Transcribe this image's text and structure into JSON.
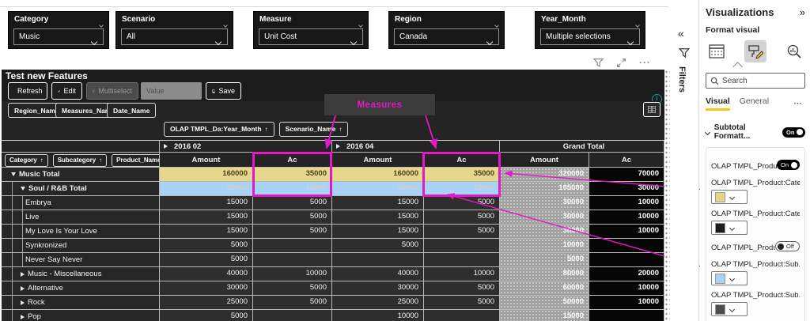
{
  "slicers": [
    {
      "label": "Category",
      "value": "Music"
    },
    {
      "label": "Scenario",
      "value": "All"
    },
    {
      "label": "Measure",
      "value": "Unit Cost"
    },
    {
      "label": "Region",
      "value": "Canada"
    },
    {
      "label": "Year_Month",
      "value": "Multiple selections"
    }
  ],
  "visual": {
    "title": "Test new Features",
    "toolbar": {
      "refresh": "Refresh",
      "edit": "Edit",
      "multiselect": "Multiselect",
      "value_placeholder": "Value",
      "save": "Save"
    },
    "field_chips": [
      "Region_Name",
      "Measures_Name",
      "Date_Name"
    ],
    "column_field_chips": [
      "OLAP TMPL_Da:Year_Month",
      "Scenario_Name"
    ],
    "row_field_chips": [
      "Category",
      "Subcategory",
      "Product_Name"
    ],
    "annotation_label": "Measures",
    "matrix": {
      "column_groups": [
        {
          "label": "2016 02",
          "collapsed": true
        },
        {
          "label": "2016 04",
          "collapsed": true
        },
        {
          "label": "Grand Total",
          "collapsed": false
        }
      ],
      "measure_headers": [
        "Amount",
        "Ac",
        "Amount",
        "Ac",
        "Amount",
        "Ac"
      ],
      "rows": [
        {
          "label": "Music Total",
          "level": 0,
          "icon": "expanded",
          "bold": true,
          "style": "yellow",
          "values": [
            "160000",
            "35000",
            "160000",
            "35000",
            "320000",
            "70000"
          ]
        },
        {
          "label": "Soul / R&B Total",
          "level": 1,
          "icon": "expanded",
          "bold": true,
          "style": "blue",
          "values": [
            "55000",
            "15000",
            "50000",
            "15000",
            "105000",
            "30000"
          ]
        },
        {
          "label": "Embrya",
          "level": 2,
          "icon": "none",
          "bold": false,
          "style": "",
          "values": [
            "15000",
            "5000",
            "15000",
            "5000",
            "30000",
            "10000"
          ]
        },
        {
          "label": "Live",
          "level": 2,
          "icon": "none",
          "bold": false,
          "style": "",
          "values": [
            "15000",
            "5000",
            "15000",
            "5000",
            "30000",
            "10000"
          ]
        },
        {
          "label": "My Love Is Your Love",
          "level": 2,
          "icon": "none",
          "bold": false,
          "style": "",
          "values": [
            "15000",
            "5000",
            "15000",
            "5000",
            "30000",
            "10000"
          ]
        },
        {
          "label": "Synkronized",
          "level": 2,
          "icon": "none",
          "bold": false,
          "style": "",
          "values": [
            "5000",
            "",
            "5000",
            "",
            "10000",
            ""
          ]
        },
        {
          "label": "Never Say Never",
          "level": 2,
          "icon": "none",
          "bold": false,
          "style": "",
          "values": [
            "5000",
            "",
            "",
            "",
            "5000",
            ""
          ]
        },
        {
          "label": "Music - Miscellaneous",
          "level": 1,
          "icon": "collapsed",
          "bold": false,
          "style": "",
          "values": [
            "40000",
            "10000",
            "40000",
            "10000",
            "80000",
            "20000"
          ]
        },
        {
          "label": "Alternative",
          "level": 1,
          "icon": "collapsed",
          "bold": false,
          "style": "",
          "values": [
            "30000",
            "5000",
            "30000",
            "5000",
            "60000",
            "10000"
          ]
        },
        {
          "label": "Rock",
          "level": 1,
          "icon": "collapsed",
          "bold": false,
          "style": "",
          "values": [
            "25000",
            "5000",
            "25000",
            "5000",
            "50000",
            "10000"
          ]
        },
        {
          "label": "Pop",
          "level": 1,
          "icon": "collapsed",
          "bold": false,
          "style": "",
          "values": [
            "5000",
            "",
            "10000",
            "",
            "15000",
            ""
          ]
        }
      ]
    }
  },
  "filters_pane": {
    "label": "Filters"
  },
  "viz_pane": {
    "title": "Visualizations",
    "subtitle": "Format visual",
    "search_placeholder": "Search",
    "tabs": [
      {
        "label": "Visual",
        "active": true
      },
      {
        "label": "General",
        "active": false
      }
    ],
    "section": {
      "label": "Subtotal Formatt...",
      "toggle": "On"
    },
    "card_items": [
      {
        "type": "toggle",
        "label": "OLAP TMPL_Produ...",
        "state": "On"
      },
      {
        "type": "swatch",
        "label": "OLAP TMPL_Product:Cate...",
        "color": "#e6d486"
      },
      {
        "type": "swatch",
        "label": "OLAP TMPL_Product:Cate...",
        "color": "#1c1c1c"
      },
      {
        "type": "toggle",
        "label": "OLAP TMPL_Produ...",
        "state": "Off"
      },
      {
        "type": "swatch",
        "label": "OLAP TMPL_Product:Sub...",
        "color": "#a9d2f7"
      },
      {
        "type": "swatch",
        "label": "OLAP TMPL_Product:Sub...",
        "color": "#4d4d4d"
      }
    ]
  },
  "glyphs": {
    "collapse_left": "«",
    "expand_right": "»",
    "more": "···",
    "sort_asc": "↑"
  },
  "colors": {
    "annotation_magenta": "#e318c8",
    "subtotal_yellow": "#e7d78b",
    "subtotal_blue": "#a9d2f7",
    "tab_accent_yellow": "#f2c811"
  }
}
